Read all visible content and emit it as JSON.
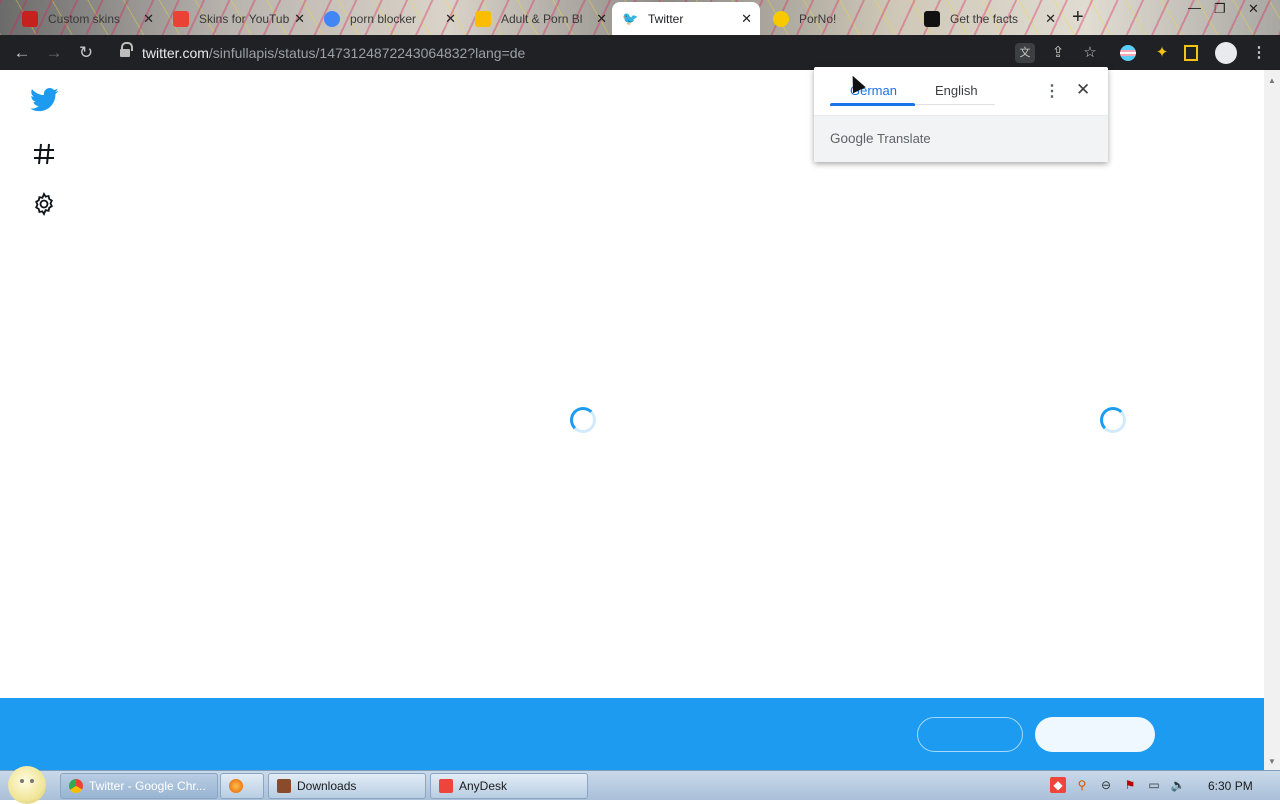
{
  "browser": {
    "tabs": [
      {
        "title": "Custom skins",
        "favicon_color": "#c5221f"
      },
      {
        "title": "Skins for YouTube",
        "favicon_color": "#ea4335"
      },
      {
        "title": "porn blocker",
        "favicon_color": "#4285f4"
      },
      {
        "title": "Adult & Porn Bl",
        "favicon_color": "#fbbc04"
      },
      {
        "title": "Twitter",
        "favicon_color": "#1d9bf0",
        "active": true
      },
      {
        "title": "PorNo!",
        "favicon_color": "#f9c900"
      },
      {
        "title": "Get the facts",
        "favicon_color": "#111111"
      }
    ],
    "new_tab": "+",
    "window_controls": {
      "minimize": "—",
      "restore": "❐",
      "close": "✕"
    },
    "nav": {
      "back": "←",
      "forward": "→",
      "reload": "↻"
    },
    "address": {
      "host": "twitter.com",
      "path": "/sinfullapis/status/1473124872243064832?lang=de"
    },
    "toolbar_icons": [
      "translate-icon",
      "share-icon",
      "star-icon",
      "extension-flag-icon",
      "puzzle-icon",
      "sidepanel-icon",
      "profile-icon",
      "kebab-menu-icon"
    ]
  },
  "twitter": {
    "brand_color": "#1d9bf0",
    "left_nav": [
      "twitter-bird-icon",
      "hashtag-icon",
      "settings-icon"
    ],
    "loading_spinners": 2
  },
  "translate_popup": {
    "source_language": "German",
    "target_language": "English",
    "more_options": "⋮",
    "close": "✕",
    "footer_brand": "Google",
    "footer_product": "Translate"
  },
  "bottom_bar": {
    "color": "#1d9bf0",
    "login_button_label": "",
    "signup_button_label": ""
  },
  "taskbar": {
    "items": [
      {
        "label": "Twitter - Google Chr...",
        "icon_color": "#4285f4",
        "active": true
      },
      {
        "label": "",
        "icon_color": "#e66000"
      },
      {
        "label": "Downloads",
        "icon_color": "#8a4b2b"
      },
      {
        "label": "AnyDesk",
        "icon_color": "#ef443b"
      }
    ],
    "clock": "6:30 PM"
  }
}
